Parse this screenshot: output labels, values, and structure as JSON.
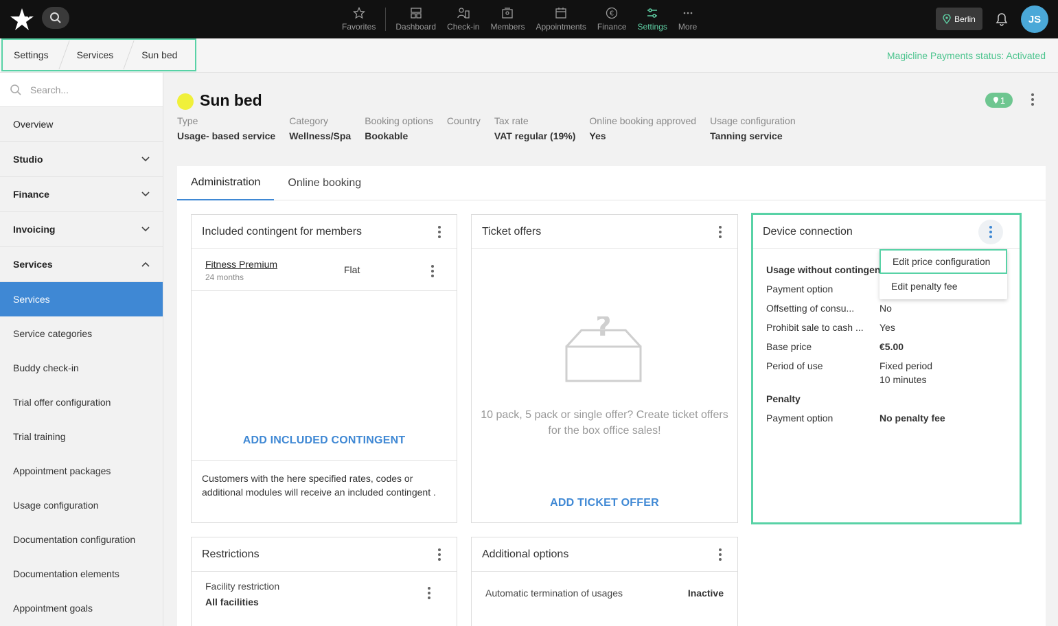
{
  "topnav": {
    "items": [
      {
        "label": "Favorites",
        "icon": "star-icon"
      },
      {
        "label": "Dashboard",
        "icon": "dashboard-icon"
      },
      {
        "label": "Check-in",
        "icon": "check-in-icon"
      },
      {
        "label": "Members",
        "icon": "members-icon"
      },
      {
        "label": "Appointments",
        "icon": "calendar-icon"
      },
      {
        "label": "Finance",
        "icon": "euro-icon"
      },
      {
        "label": "Settings",
        "icon": "settings-icon"
      },
      {
        "label": "More",
        "icon": "more-icon"
      }
    ],
    "active": "Settings",
    "location": "Berlin",
    "avatar_initials": "JS"
  },
  "breadcrumb": [
    "Settings",
    "Services",
    "Sun bed"
  ],
  "payments_status": "Magicline Payments status: Activated",
  "sidebar": {
    "search_placeholder": "Search...",
    "items": [
      {
        "label": "Overview"
      },
      {
        "label": "Studio"
      },
      {
        "label": "Finance"
      },
      {
        "label": "Invoicing"
      },
      {
        "label": "Services"
      },
      {
        "label": "Services"
      },
      {
        "label": "Service categories"
      },
      {
        "label": "Buddy check-in"
      },
      {
        "label": "Trial offer configuration"
      },
      {
        "label": "Trial training"
      },
      {
        "label": "Appointment packages"
      },
      {
        "label": "Usage configuration"
      },
      {
        "label": "Documentation configuration"
      },
      {
        "label": "Documentation elements"
      },
      {
        "label": "Appointment goals"
      }
    ]
  },
  "service": {
    "title": "Sun bed",
    "dot_color": "#f0f03a",
    "badge": "1",
    "meta": [
      {
        "label": "Type",
        "value": "Usage- based service"
      },
      {
        "label": "Category",
        "value": "Wellness/Spa"
      },
      {
        "label": "Booking options",
        "value": "Bookable"
      },
      {
        "label": "Country",
        "value": ""
      },
      {
        "label": "Tax rate",
        "value": "VAT regular (19%)"
      },
      {
        "label": "Online booking approved",
        "value": "Yes"
      },
      {
        "label": "Usage configuration",
        "value": "Tanning service"
      }
    ]
  },
  "tabs": [
    "Administration",
    "Online booking"
  ],
  "cards": {
    "contingent": {
      "title": "Included contingent for members",
      "rate_name": "Fitness Premium",
      "rate_duration": "24 months",
      "rate_type": "Flat",
      "action": "ADD INCLUDED CONTINGENT",
      "note": "Customers with the here specified rates, codes or additional modules will receive an included contingent ."
    },
    "tickets": {
      "title": "Ticket offers",
      "empty_text": "10 pack, 5 pack or single offer? Create ticket offers for the box office sales!",
      "action": "ADD TICKET OFFER"
    },
    "device": {
      "title": "Device connection",
      "section1": "Usage without contingent",
      "rows": [
        {
          "label": "Payment option",
          "value": ""
        },
        {
          "label": "Offsetting of consu...",
          "value": "No"
        },
        {
          "label": "Prohibit sale to cash ...",
          "value": "Yes"
        },
        {
          "label": "Base price",
          "value": "€5.00"
        },
        {
          "label": "Period of use",
          "value": "Fixed period"
        }
      ],
      "period_detail": "10 minutes",
      "section2": "Penalty",
      "penalty_label": "Payment option",
      "penalty_value": "No penalty fee"
    },
    "restrictions": {
      "title": "Restrictions",
      "label": "Facility restriction",
      "value": "All facilities"
    },
    "additional": {
      "title": "Additional options",
      "label": "Automatic termination of usages",
      "value": "Inactive"
    }
  },
  "dropdown": [
    "Edit price configuration",
    "Edit penalty fee"
  ]
}
